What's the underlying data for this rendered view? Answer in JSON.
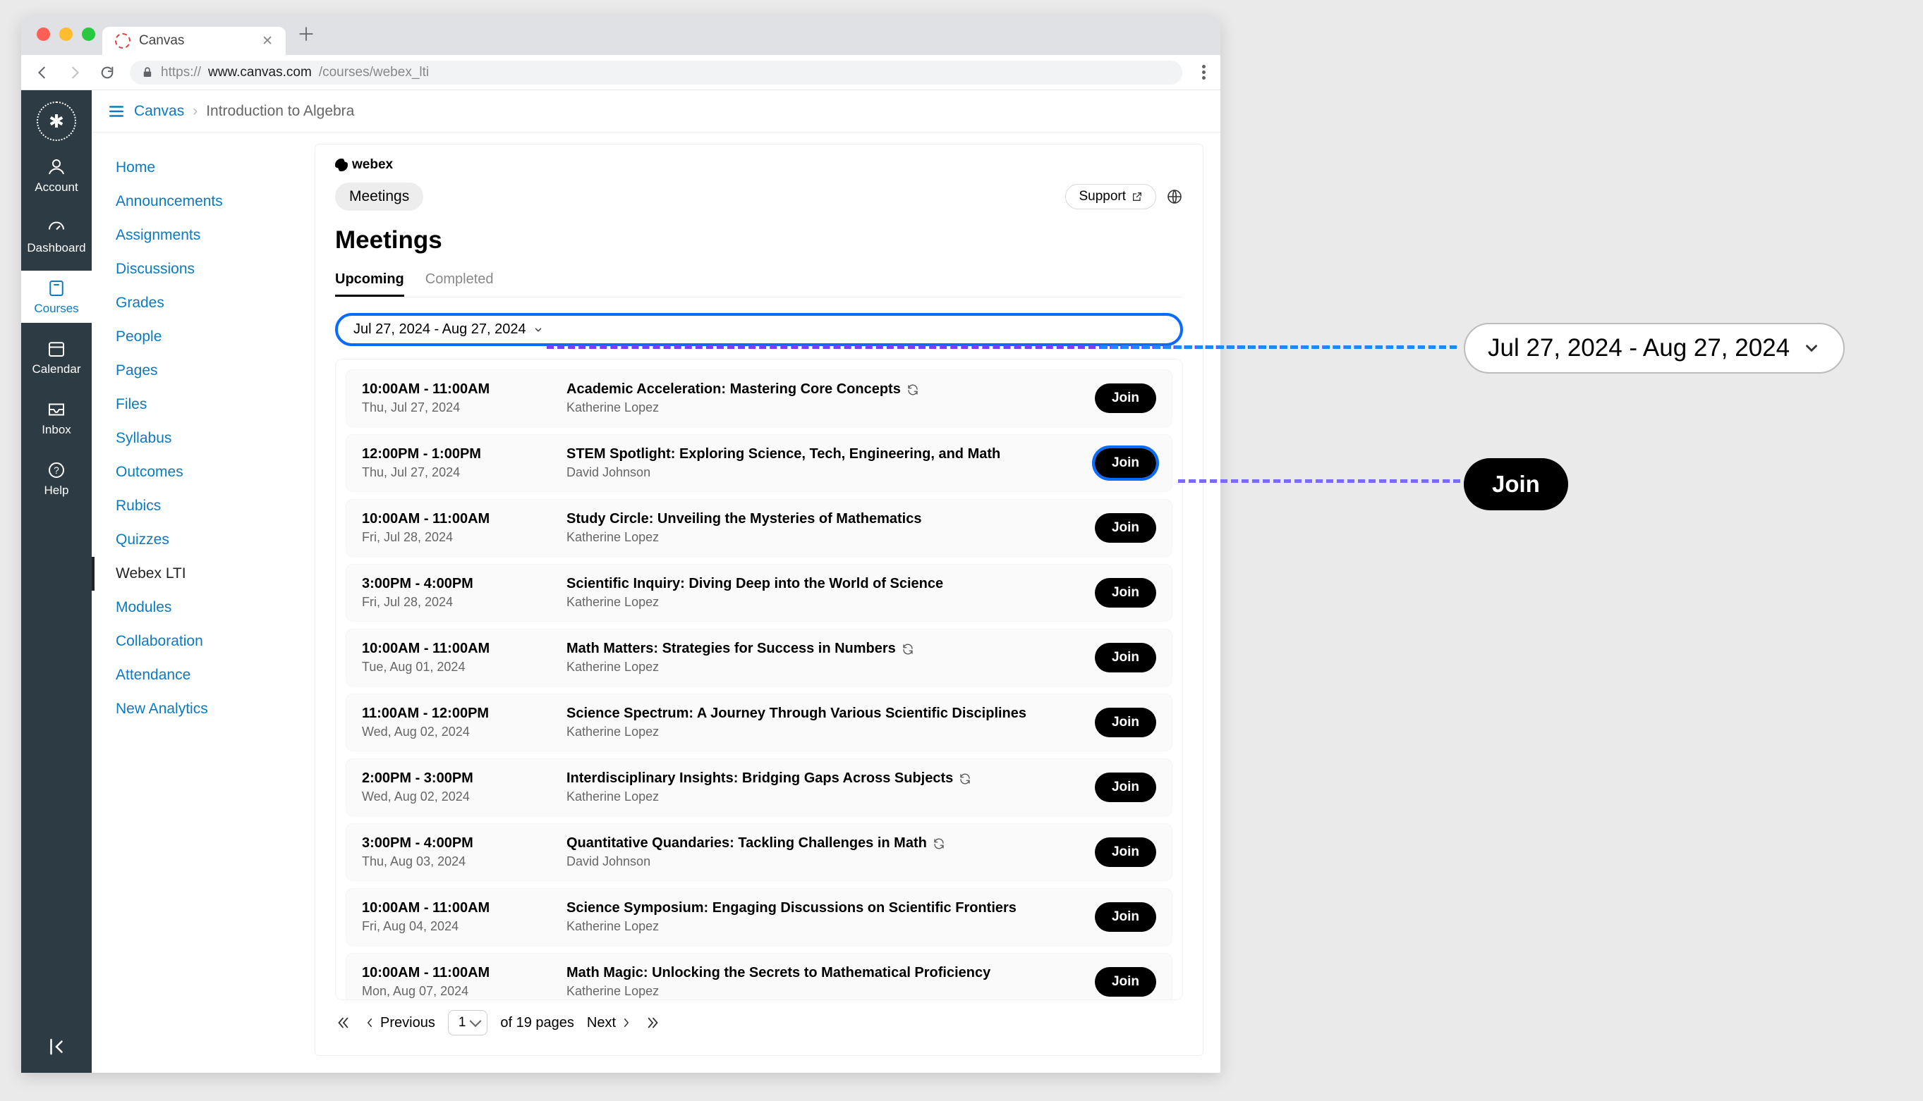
{
  "browser": {
    "tab_title": "Canvas",
    "url_scheme": "https://",
    "url_host": "www.canvas.com",
    "url_path": "/courses/webex_lti"
  },
  "breadcrumb": {
    "root": "Canvas",
    "course": "Introduction to Algebra"
  },
  "rail": [
    {
      "label": "Account"
    },
    {
      "label": "Dashboard"
    },
    {
      "label": "Courses"
    },
    {
      "label": "Calendar"
    },
    {
      "label": "Inbox"
    },
    {
      "label": "Help"
    }
  ],
  "sidenav": [
    "Home",
    "Announcements",
    "Assignments",
    "Discussions",
    "Grades",
    "People",
    "Pages",
    "Files",
    "Syllabus",
    "Outcomes",
    "Rubics",
    "Quizzes",
    "Webex LTI",
    "Modules",
    "Collaboration",
    "Attendance",
    "New Analytics"
  ],
  "sidenav_active": "Webex LTI",
  "webex": {
    "logo": "webex",
    "pill": "Meetings",
    "support": "Support",
    "heading": "Meetings",
    "tab_upcoming": "Upcoming",
    "tab_completed": "Completed",
    "range": "Jul 27, 2024 - Aug 27, 2024",
    "callout_range": "Jul 27, 2024 - Aug 27, 2024",
    "callout_join": "Join"
  },
  "meetings": [
    {
      "time": "10:00AM - 11:00AM",
      "date": "Thu, Jul 27, 2024",
      "title": "Academic Acceleration: Mastering Core Concepts",
      "host": "Katherine Lopez",
      "recurring": true,
      "join": "Join"
    },
    {
      "time": "12:00PM - 1:00PM",
      "date": "Thu, Jul 27, 2024",
      "title": "STEM Spotlight: Exploring Science, Tech, Engineering, and Math",
      "host": "David Johnson",
      "recurring": false,
      "join": "Join",
      "highlight": true
    },
    {
      "time": "10:00AM - 11:00AM",
      "date": "Fri, Jul 28, 2024",
      "title": "Study Circle: Unveiling the Mysteries of Mathematics",
      "host": "Katherine Lopez",
      "recurring": false,
      "join": "Join"
    },
    {
      "time": "3:00PM - 4:00PM",
      "date": "Fri, Jul 28, 2024",
      "title": "Scientific Inquiry: Diving Deep into the World of Science",
      "host": "Katherine Lopez",
      "recurring": false,
      "join": "Join"
    },
    {
      "time": "10:00AM - 11:00AM",
      "date": "Tue, Aug 01, 2024",
      "title": "Math Matters: Strategies for Success in Numbers",
      "host": "Katherine Lopez",
      "recurring": true,
      "join": "Join"
    },
    {
      "time": "11:00AM - 12:00PM",
      "date": "Wed, Aug 02, 2024",
      "title": "Science Spectrum: A Journey Through Various Scientific Disciplines",
      "host": "Katherine Lopez",
      "recurring": false,
      "join": "Join"
    },
    {
      "time": "2:00PM - 3:00PM",
      "date": "Wed, Aug 02, 2024",
      "title": "Interdisciplinary Insights: Bridging Gaps Across Subjects",
      "host": "Katherine Lopez",
      "recurring": true,
      "join": "Join"
    },
    {
      "time": "3:00PM - 4:00PM",
      "date": "Thu, Aug 03, 2024",
      "title": "Quantitative Quandaries: Tackling Challenges in Math",
      "host": "David Johnson",
      "recurring": true,
      "join": "Join"
    },
    {
      "time": "10:00AM - 11:00AM",
      "date": "Fri, Aug 04, 2024",
      "title": "Science Symposium: Engaging Discussions on Scientific Frontiers",
      "host": "Katherine Lopez",
      "recurring": false,
      "join": "Join"
    },
    {
      "time": "10:00AM - 11:00AM",
      "date": "Mon, Aug 07, 2024",
      "title": "Math Magic: Unlocking the Secrets to Mathematical Proficiency",
      "host": "Katherine Lopez",
      "recurring": false,
      "join": "Join"
    }
  ],
  "pager": {
    "prev": "Previous",
    "next": "Next",
    "page": "1",
    "of": "of 19 pages"
  }
}
